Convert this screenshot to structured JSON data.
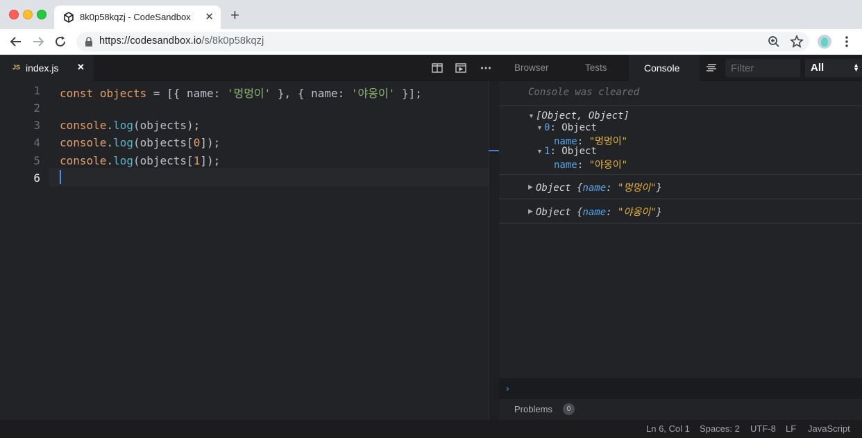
{
  "browser": {
    "tab_title": "8k0p58kqzj - CodeSandbox",
    "tab_close": "✕",
    "new_tab": "+",
    "url_host": "https://codesandbox.io",
    "url_path": "/s/8k0p58kqzj"
  },
  "editor": {
    "tab_badge": "JS",
    "tab_file": "index.js",
    "tab_close": "✕",
    "lines": [
      {
        "num": "1"
      },
      {
        "num": "2"
      },
      {
        "num": "3"
      },
      {
        "num": "4"
      },
      {
        "num": "5"
      },
      {
        "num": "6"
      }
    ],
    "code": {
      "l1": {
        "kw": "const",
        "sp1": " ",
        "id": "objects",
        "rest1": " = [{ name: ",
        "s1": "'멍멍이'",
        "rest2": " }, { name: ",
        "s2": "'야옹이'",
        "rest3": " }];"
      },
      "l3": {
        "obj": "console",
        "dot": ".",
        "fn": "log",
        "rest": "(objects);"
      },
      "l4": {
        "obj": "console",
        "dot": ".",
        "fn": "log",
        "rest1": "(objects[",
        "num": "0",
        "rest2": "]);"
      },
      "l5": {
        "obj": "console",
        "dot": ".",
        "fn": "log",
        "rest1": "(objects[",
        "num": "1",
        "rest2": "]);"
      }
    }
  },
  "panel": {
    "tabs": {
      "browser": "Browser",
      "tests": "Tests",
      "console": "Console"
    },
    "filter_placeholder": "Filter",
    "level_select": "All"
  },
  "console": {
    "cleared": "Console was cleared",
    "entry1": {
      "summary": "[Object, Object]",
      "item0_key": "0",
      "item0_type": ": Object",
      "item0_prop": "name",
      "item0_val": "\"멍멍이\"",
      "item1_key": "1",
      "item1_type": ": Object",
      "item1_prop": "name",
      "item1_val": "\"야옹이\""
    },
    "entry2": {
      "prefix": "Object {",
      "prop": "name",
      "sep": ": ",
      "val": "\"멍멍이\"",
      "suffix": "}"
    },
    "entry3": {
      "prefix": "Object {",
      "prop": "name",
      "sep": ": ",
      "val": "\"야옹이\"",
      "suffix": "}"
    },
    "prompt": "›"
  },
  "problems": {
    "label": "Problems",
    "count": "0"
  },
  "status": {
    "position": "Ln 6, Col 1",
    "spaces": "Spaces: 2",
    "encoding": "UTF-8",
    "eol": "LF",
    "language": "JavaScript"
  },
  "colors": {
    "accent": "#4d8ef0",
    "string": "#8fb36e",
    "keyword": "#e4a06a",
    "function": "#58b4c7"
  }
}
